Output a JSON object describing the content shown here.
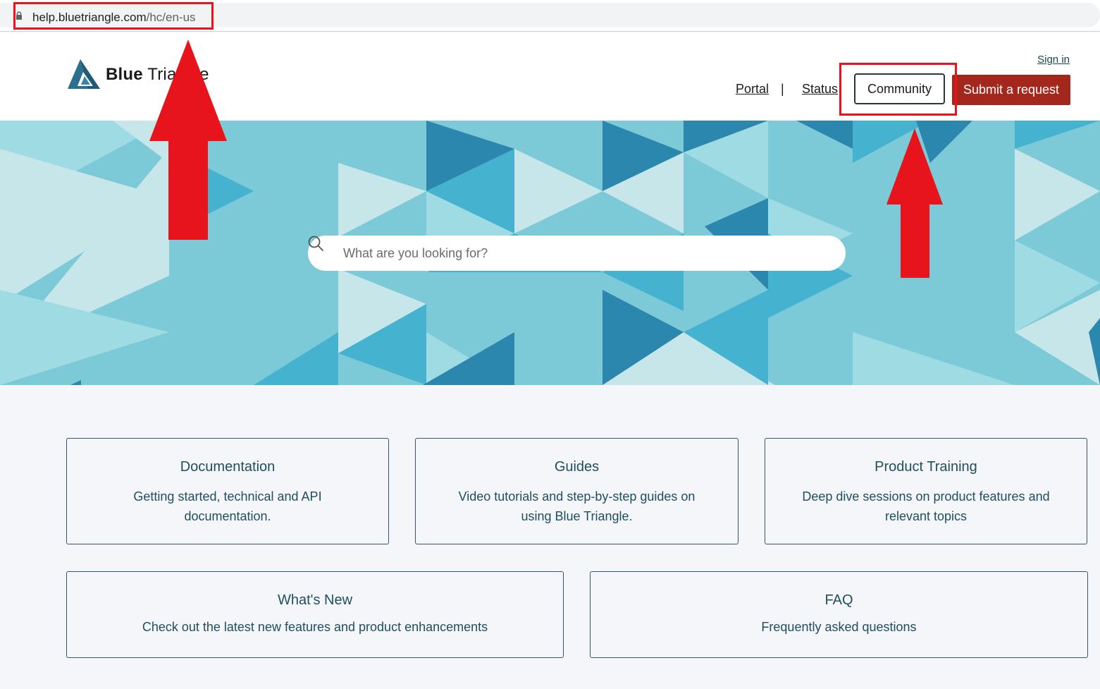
{
  "browser": {
    "url_host": "help.bluetriangle.com",
    "url_path": "/hc/en-us"
  },
  "header": {
    "logo_text_bold": "Blue",
    "logo_text_rest": " Triangle",
    "sign_in": "Sign in",
    "nav": {
      "portal": "Portal",
      "separator": "|",
      "status": "Status",
      "community": "Community",
      "submit": "Submit a request"
    }
  },
  "search": {
    "placeholder": "What are you looking for?"
  },
  "cards": [
    {
      "title": "Documentation",
      "desc": "Getting started, technical and API documentation."
    },
    {
      "title": "Guides",
      "desc": "Video tutorials and step-by-step guides on using Blue Triangle."
    },
    {
      "title": "Product Training",
      "desc": "Deep dive sessions on product features and relevant topics"
    },
    {
      "title": "What's New",
      "desc": "Check out the latest new features and product enhancements"
    },
    {
      "title": "FAQ",
      "desc": "Frequently asked questions"
    }
  ],
  "colors": {
    "accent_red": "#a3271c",
    "annotation_red": "#e8141c",
    "hero_base": "#7cc9d7",
    "card_text": "#1f4e5f"
  }
}
